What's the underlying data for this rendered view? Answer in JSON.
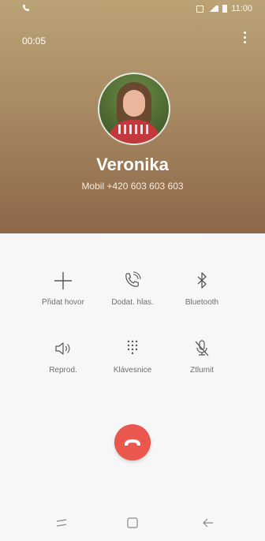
{
  "status_bar": {
    "time": "11:00"
  },
  "call": {
    "timer": "00:05",
    "contact_name": "Veronika",
    "number_line": "Mobil  +420 603 603 603"
  },
  "controls": [
    {
      "label": "Přidat hovor",
      "icon": "plus-icon"
    },
    {
      "label": "Dodat. hlas.",
      "icon": "phone-voice-icon"
    },
    {
      "label": "Bluetooth",
      "icon": "bluetooth-icon"
    },
    {
      "label": "Reprod.",
      "icon": "speaker-icon"
    },
    {
      "label": "Klávesnice",
      "icon": "keypad-icon"
    },
    {
      "label": "Ztlumit",
      "icon": "mute-mic-icon"
    }
  ],
  "colors": {
    "header_gradient_top": "#bba376",
    "header_gradient_bottom": "#8d6748",
    "end_call": "#e9574f",
    "label_text": "#6f6f6f"
  }
}
